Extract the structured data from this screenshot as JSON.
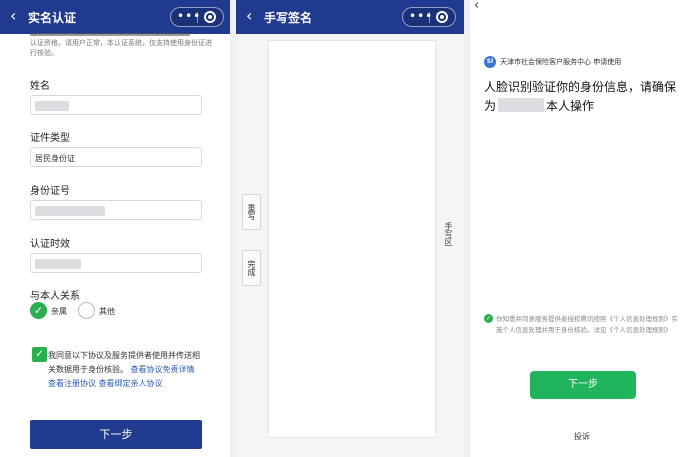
{
  "panel1": {
    "title": "实名认证",
    "notice": "认证资格，请用户正常，本认证系统，仅支持使用身份证进行核验。",
    "fields": [
      {
        "label": "姓名",
        "value": ""
      },
      {
        "label": "证件类型",
        "value": "居民身份证"
      },
      {
        "label": "身份证号",
        "value": ""
      },
      {
        "label": "认证时效",
        "value": ""
      }
    ],
    "relation_label": "与本人关系",
    "relation_options": [
      "亲属",
      "其他"
    ],
    "agree_text": "我同意以下协议及服务提供者使用并传送相关数据用于身份核验。",
    "agree_links": [
      "查看协议免责详情",
      "查看注册协议",
      "查看绑定亲人协议"
    ],
    "next_label": "下一步"
  },
  "panel2": {
    "title": "手写签名",
    "buttons": [
      "重写",
      "完成"
    ],
    "hint": "手写区"
  },
  "panel3": {
    "org": "天津市社会保险客户服务中心 申请使用",
    "heading_pre": "人脸识别验证你的身份信息，请确保为",
    "heading_post": "本人操作",
    "note": "你知悉并同意服务提供者授权腾讯按照《个人信息处理规则》实施个人信息处理并用于身份核验。详见《个人信息处理规则》",
    "next_label": "下一步",
    "complain_label": "投诉"
  },
  "icons": {
    "back": "‹",
    "more": "•••",
    "check": "✓"
  },
  "colors": {
    "nav": "#1f3a8f",
    "green": "#2bae4d",
    "button_green": "#20b55c"
  }
}
